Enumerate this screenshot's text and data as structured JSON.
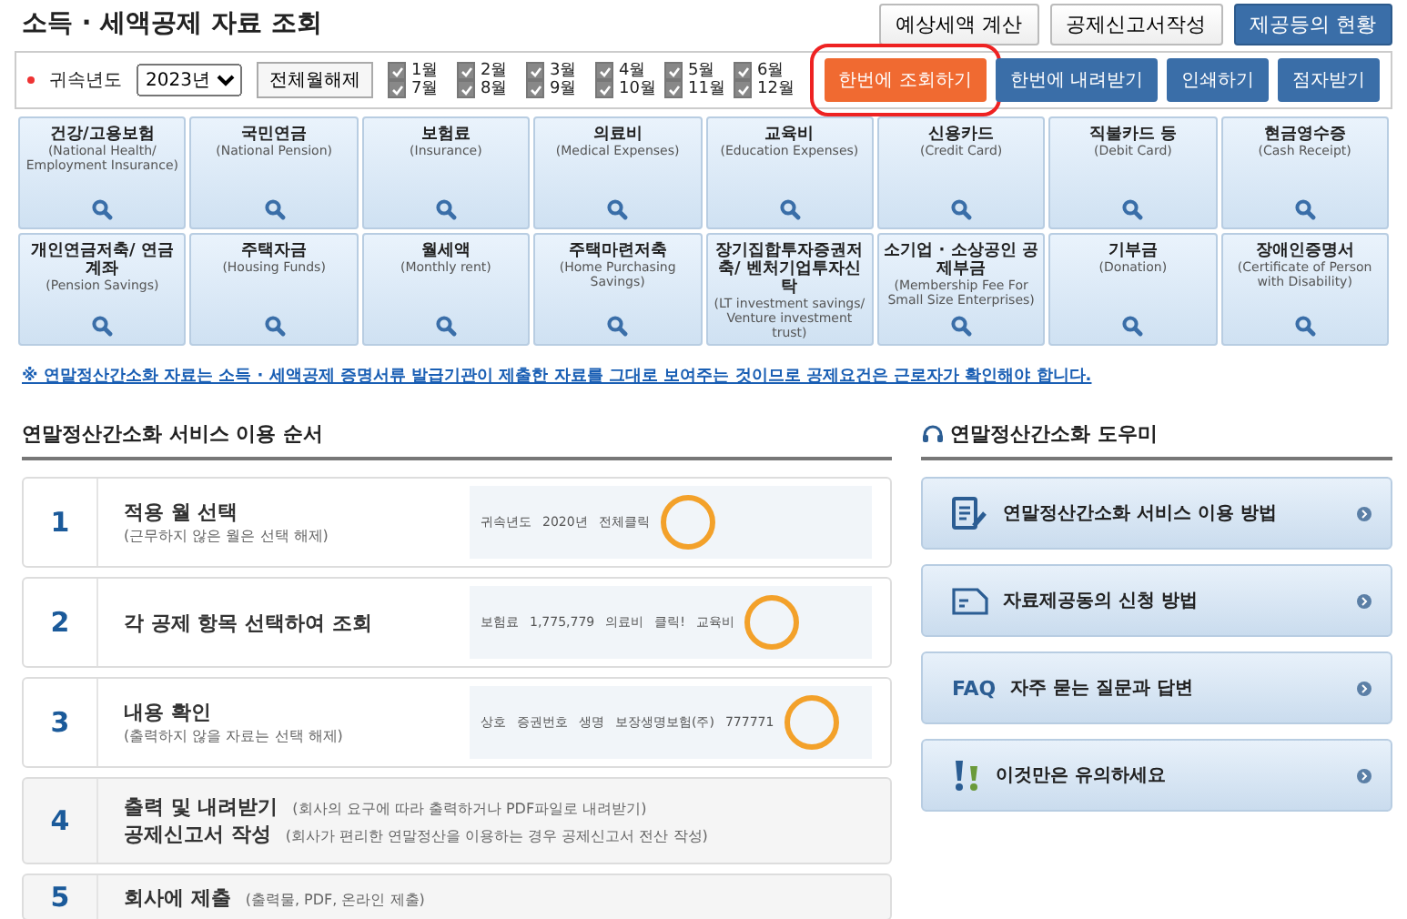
{
  "title": "소득 · 세액공제 자료 조회",
  "header_buttons": [
    {
      "label": "예상세액 계산",
      "kind": "plain"
    },
    {
      "label": "공제신고서작성",
      "kind": "plain"
    },
    {
      "label": "제공등의 현황",
      "kind": "primary"
    }
  ],
  "filter": {
    "year_label": "귀속년도",
    "year_value": "2023년",
    "clear_button": "전체월해제",
    "months": [
      {
        "label": "1월",
        "checked": true
      },
      {
        "label": "2월",
        "checked": true
      },
      {
        "label": "3월",
        "checked": true
      },
      {
        "label": "4월",
        "checked": true
      },
      {
        "label": "5월",
        "checked": true
      },
      {
        "label": "6월",
        "checked": true
      },
      {
        "label": "7월",
        "checked": true
      },
      {
        "label": "8월",
        "checked": true
      },
      {
        "label": "9월",
        "checked": true
      },
      {
        "label": "10월",
        "checked": true
      },
      {
        "label": "11월",
        "checked": true
      },
      {
        "label": "12월",
        "checked": true
      }
    ],
    "action_buttons": [
      {
        "label": "한번에 조회하기",
        "kind": "orange",
        "highlighted": true
      },
      {
        "label": "한번에 내려받기",
        "kind": "blue",
        "highlighted": false
      },
      {
        "label": "인쇄하기",
        "kind": "blue",
        "highlighted": false
      },
      {
        "label": "점자받기",
        "kind": "blue",
        "highlighted": false
      }
    ]
  },
  "categories": [
    {
      "title": "건강/고용보험",
      "subtitle": "(National Health/ Employment Insurance)"
    },
    {
      "title": "국민연금",
      "subtitle": "(National Pension)"
    },
    {
      "title": "보험료",
      "subtitle": "(Insurance)"
    },
    {
      "title": "의료비",
      "subtitle": "(Medical Expenses)"
    },
    {
      "title": "교육비",
      "subtitle": "(Education Expenses)"
    },
    {
      "title": "신용카드",
      "subtitle": "(Credit Card)"
    },
    {
      "title": "직불카드 등",
      "subtitle": "(Debit Card)"
    },
    {
      "title": "현금영수증",
      "subtitle": "(Cash Receipt)"
    },
    {
      "title": "개인연금저축/ 연금계좌",
      "subtitle": "(Pension Savings)"
    },
    {
      "title": "주택자금",
      "subtitle": "(Housing Funds)"
    },
    {
      "title": "월세액",
      "subtitle": "(Monthly rent)"
    },
    {
      "title": "주택마련저축",
      "subtitle": "(Home Purchasing Savings)"
    },
    {
      "title": "장기집합투자증권저축/ 벤처기업투자신탁",
      "subtitle": "(LT investment savings/ Venture investment trust)"
    },
    {
      "title": "소기업 · 소상공인 공제부금",
      "subtitle": "(Membership Fee For Small Size Enterprises)"
    },
    {
      "title": "기부금",
      "subtitle": "(Donation)"
    },
    {
      "title": "장애인증명서",
      "subtitle": "(Certificate of Person with Disability)"
    }
  ],
  "notice": "※ 연말정산간소화 자료는 소득 · 세액공제 증명서류 발급기관이 제출한 자료를 그대로 보여주는 것이므로 공제요건은 근로자가 확인해야 합니다.",
  "steps": {
    "title": "연말정산간소화 서비스 이용 순서",
    "items": [
      {
        "number": "1",
        "kind": "stacked",
        "lines": [
          {
            "title": "적용 월 선택",
            "note": "(근무하지 않은 월은 선택 해제)"
          }
        ],
        "illustration": {
          "labels": [
            "귀속년도",
            "2020년",
            "전체클릭"
          ]
        }
      },
      {
        "number": "2",
        "kind": "stacked",
        "lines": [
          {
            "title": "각 공제 항목 선택하여 조회"
          }
        ],
        "illustration": {
          "labels": [
            "보험료",
            "1,775,779",
            "의료비",
            "클릭!",
            "교육비"
          ]
        }
      },
      {
        "number": "3",
        "kind": "stacked",
        "lines": [
          {
            "title": "내용 확인",
            "note": "(출력하지 않을 자료는 선택 해제)"
          }
        ],
        "illustration": {
          "labels": [
            "상호",
            "증권번호",
            "생명",
            "보장생명보험(주)",
            "777771"
          ]
        }
      },
      {
        "number": "4",
        "kind": "inline",
        "lines": [
          {
            "title": "출력 및 내려받기",
            "note": "(회사의 요구에 따라 출력하거나 PDF파일로 내려받기)"
          },
          {
            "title": "공제신고서 작성",
            "note": "(회사가 편리한 연말정산을 이용하는 경우 공제신고서 전산 작성)"
          }
        ]
      },
      {
        "number": "5",
        "kind": "inline",
        "lines": [
          {
            "title": "회사에 제출",
            "note": "(출력물, PDF, 온라인 제출)"
          }
        ]
      }
    ]
  },
  "help": {
    "title": "연말정산간소화 도우미",
    "items": [
      {
        "kind": "guide",
        "label": "연말정산간소화 서비스 이용 방법"
      },
      {
        "kind": "form",
        "label": "자료제공동의 신청 방법"
      },
      {
        "kind": "faq",
        "badge": "FAQ",
        "label": "자주 묻는 질문과 답변"
      },
      {
        "kind": "warning",
        "label": "이것만은 유의하세요"
      }
    ]
  }
}
